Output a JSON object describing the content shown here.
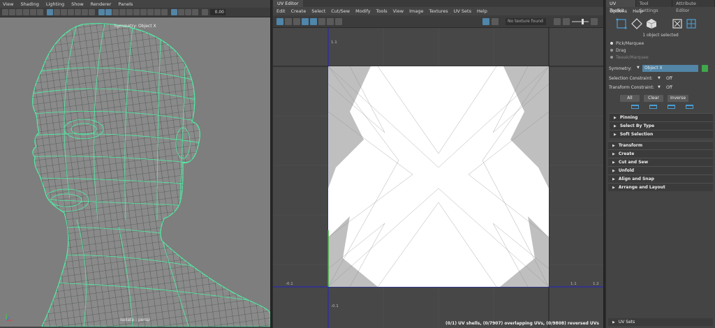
{
  "viewport": {
    "menu": [
      "View",
      "Shading",
      "Lighting",
      "Show",
      "Renderer",
      "Panels"
    ],
    "number_field": "0.00",
    "symmetry_label": "Symmetry: Object X",
    "camera_label": "Isolate : persp",
    "mesh_color": "#4cf0a4",
    "background_color": "#7e7e7e"
  },
  "uv_editor": {
    "tab": "UV Editor",
    "menu": [
      "Edit",
      "Create",
      "Select",
      "Cut/Sew",
      "Modify",
      "Tools",
      "View",
      "Image",
      "Textures",
      "UV Sets",
      "Help"
    ],
    "texture_field": "No texture found",
    "axis_labels": {
      "top_v": "1.1",
      "bottom_v": "-0.1",
      "left_u": "-0.1",
      "right_u_near": "1.1",
      "right_u_far": "1.2"
    },
    "status": "(0/1) UV shells, (0/7907) overlapping UVs, (0/9808) reversed UVs"
  },
  "right_panel": {
    "tabs": [
      "UV Toolkit",
      "Tool Settings",
      "Attribute Editor"
    ],
    "active_tab": "UV Toolkit",
    "menu": [
      "Options",
      "Help"
    ],
    "selected_text": "1 object selected",
    "modes": [
      {
        "label": "Pick/Marquee",
        "on": true
      },
      {
        "label": "Drag",
        "on": false
      },
      {
        "label": "Tweak/Marquee",
        "on": false
      }
    ],
    "symmetry": {
      "label": "Symmetry:",
      "value": "Object X"
    },
    "selection_constraint": {
      "label": "Selection Constraint:",
      "value": "Off"
    },
    "transform_constraint": {
      "label": "Transform Constraint:",
      "value": "Off"
    },
    "buttons": [
      "All",
      "Clear",
      "Inverse"
    ],
    "subsections": [
      "Pinning",
      "Select By Type",
      "Soft Selection"
    ],
    "sections": [
      "Transform",
      "Create",
      "Cut and Sew",
      "Unfold",
      "Align and Snap",
      "Arrange and Layout"
    ],
    "bottom_section": "UV Sets"
  }
}
